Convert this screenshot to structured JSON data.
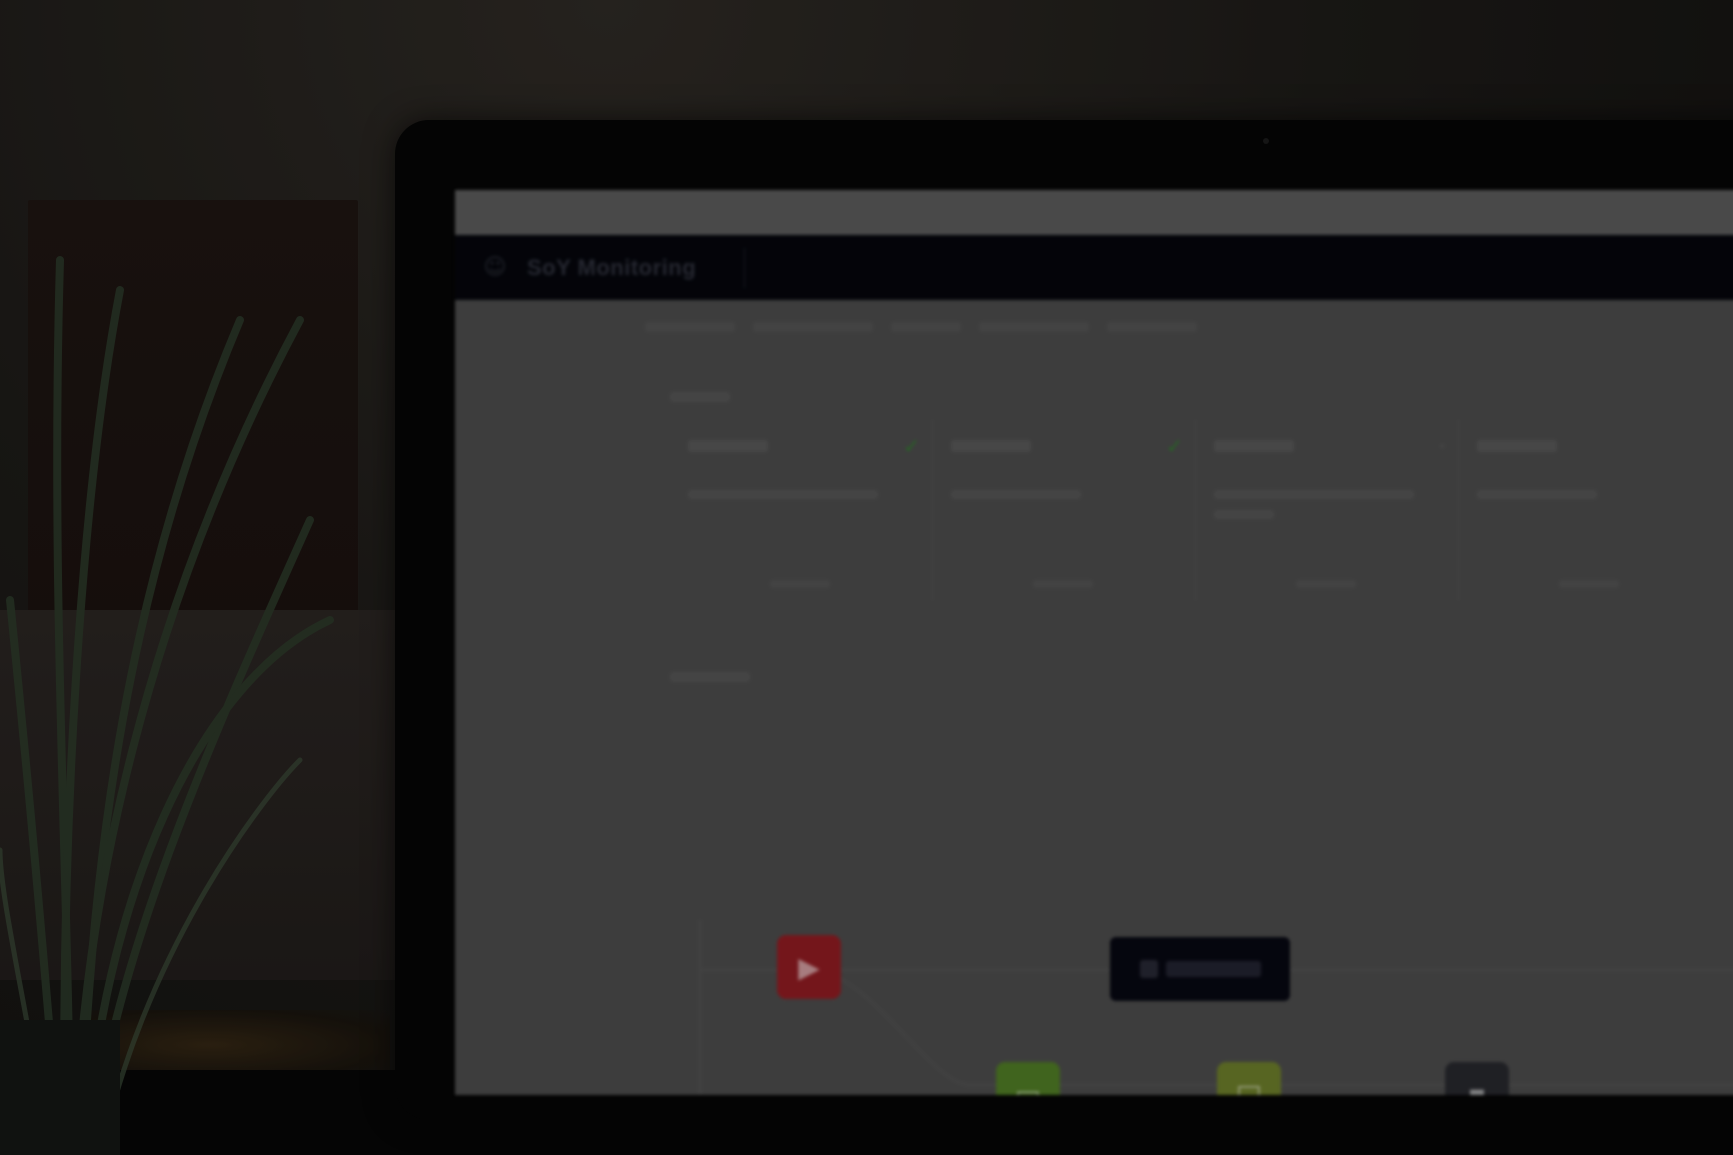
{
  "screen_app": {
    "logo_icon": "chat-bubble-icon",
    "logo_glyph": "☺",
    "title": "SoY Monitoring"
  },
  "flow": {
    "nodes": [
      {
        "icon": "play-icon",
        "color": "#8e1c22"
      },
      {
        "icon": "box-icon",
        "color": "#4f7a25"
      },
      {
        "icon": "square-icon",
        "color": "#6b7c2a"
      },
      {
        "icon": "pause-icon",
        "color": "#27282d"
      },
      {
        "icon": "blue-block-icon",
        "color": "#1f4d78"
      },
      {
        "icon": "red-block-icon",
        "color": "#8e1c22"
      }
    ]
  },
  "colors": {
    "screen_bg": "#4a4a4a",
    "header_bg": "#05060c",
    "check_green": "#2f7a2c",
    "bezel": "#050505"
  }
}
